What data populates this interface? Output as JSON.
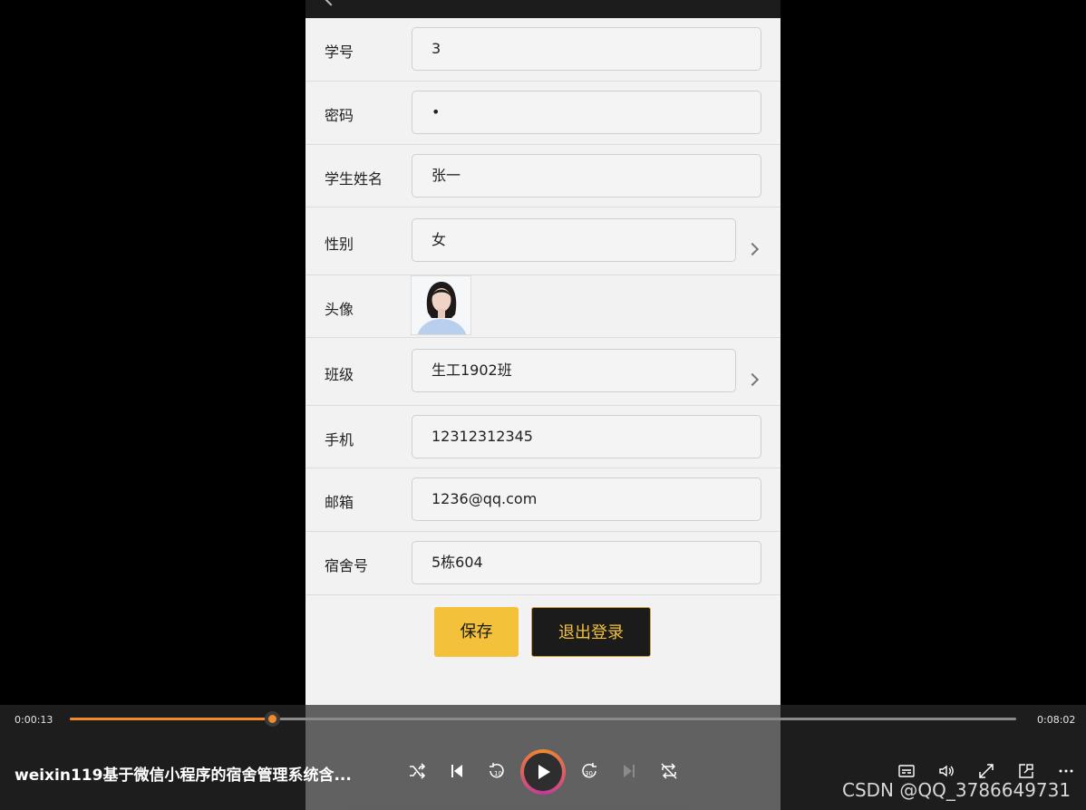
{
  "form": {
    "student_id": {
      "label": "学号",
      "value": "3"
    },
    "password": {
      "label": "密码",
      "value": "•"
    },
    "student_name": {
      "label": "学生姓名",
      "value": "张一"
    },
    "gender": {
      "label": "性别",
      "value": "女"
    },
    "avatar": {
      "label": "头像"
    },
    "class": {
      "label": "班级",
      "value": "生工1902班"
    },
    "phone": {
      "label": "手机",
      "value": "12312312345"
    },
    "email": {
      "label": "邮箱",
      "value": "1236@qq.com"
    },
    "dorm": {
      "label": "宿舍号",
      "value": "5栋604"
    }
  },
  "buttons": {
    "save": "保存",
    "logout": "退出登录"
  },
  "player": {
    "current_time": "0:00:13",
    "total_time": "0:08:02",
    "progress": 0.214,
    "title": "weixin119基于微信小程序的宿舍管理系统含...",
    "accent": "#f08a2c",
    "controls": [
      "shuffle-icon",
      "previous-icon",
      "rewind-10-icon",
      "play-icon",
      "forward-30-icon",
      "next-icon",
      "repeat-off-icon",
      "subtitles-icon",
      "volume-icon",
      "fullscreen-icon",
      "mini-player-icon",
      "more-icon"
    ]
  },
  "watermark": "CSDN @QQ_3786649731",
  "colors": {
    "save_button": "#f3c13a",
    "logout_button": "#1b1b1b"
  }
}
